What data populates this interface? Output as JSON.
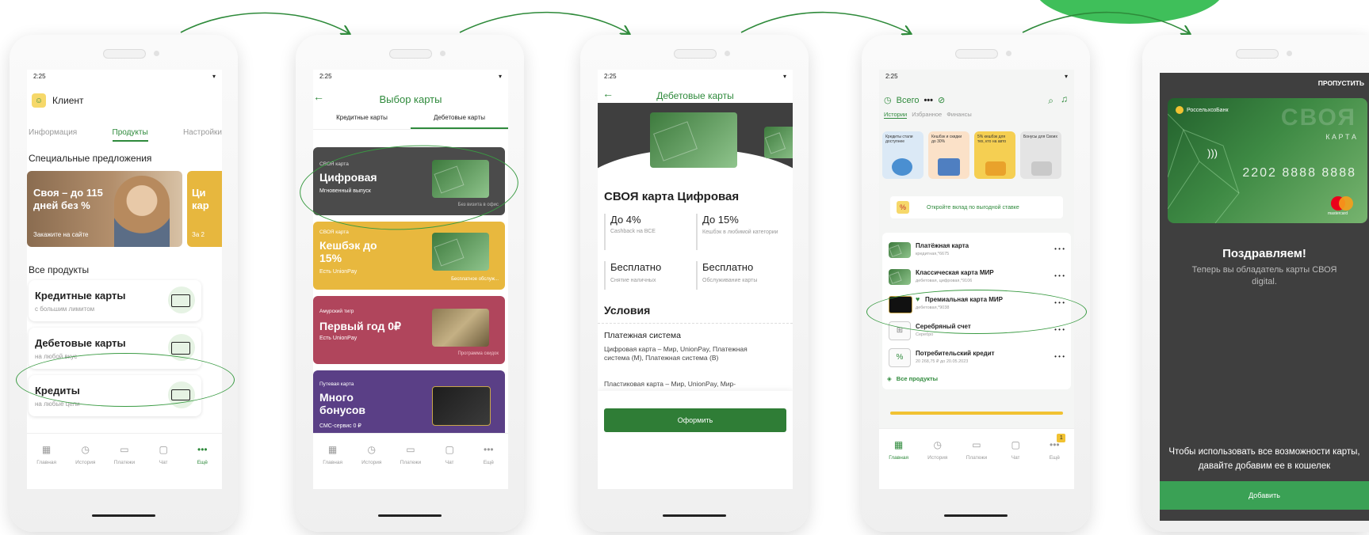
{
  "colors": {
    "accent": "#2f8a3c",
    "arrow": "#2e8a3a",
    "circle": "#3a9b43",
    "blob": "#3fbf5a"
  },
  "status_time": "2:25",
  "tabbar": {
    "home": "Главная",
    "history": "История",
    "payments": "Платежи",
    "chat": "Чат",
    "more": "Ещё"
  },
  "screen1": {
    "header": "Клиент",
    "tabs": [
      "Информация",
      "Продукты",
      "Настройки"
    ],
    "special_title": "Специальные предложения",
    "promo_title": "Своя – до 115 дней без %",
    "promo_sub": "Закажите на сайте",
    "promo2_title": "Ци кар",
    "promo2_sub": "За 2",
    "all_products": "Все продукты",
    "products": [
      {
        "title": "Кредитные карты",
        "subtitle": "с большим лимитом"
      },
      {
        "title": "Дебетовые карты",
        "subtitle": "на любой вкус"
      },
      {
        "title": "Кредиты",
        "subtitle": "на любые цели"
      }
    ]
  },
  "screen2": {
    "title": "Выбор карты",
    "tabs": [
      "Кредитные карты",
      "Дебетовые карты"
    ],
    "cards": [
      {
        "kicker": "СВОЯ карта",
        "title": "Цифровая",
        "subtitle": "Мгновенный выпуск",
        "note": "Без визита в офис",
        "bg": "#4b4b4b"
      },
      {
        "kicker": "СВОЯ карта",
        "title": "Кешбэк до 15%",
        "subtitle": "Есть UnionPay",
        "note": "Бесплатное обслуж...",
        "bg": "#e8b83e"
      },
      {
        "kicker": "Амурский тигр",
        "title": "Первый год 0₽",
        "subtitle": "Есть UnionPay",
        "note": "Программа скидок",
        "bg": "#b0455c"
      },
      {
        "kicker": "Путевая карта",
        "title": "Много бонусов",
        "subtitle": "СМС-сервис 0 ₽",
        "note": "",
        "bg": "#5a3f86"
      }
    ]
  },
  "screen3": {
    "title": "Дебетовые карты",
    "card_name": "СВОЯ карта Цифровая",
    "features": [
      {
        "value": "До 4%",
        "label": "Cashback на ВСЕ"
      },
      {
        "value": "До 15%",
        "label": "Кешбэк в любимой категории"
      },
      {
        "value": "Бесплатно",
        "label": "Снятие наличных"
      },
      {
        "value": "Бесплатно",
        "label": "Обслуживание карты"
      }
    ],
    "conditions": "Условия",
    "payment_system_title": "Платежная система",
    "payment_system_text": "Цифровая карта – Мир, UnionPay, Платежная система (М), Платежная система (В)",
    "plastic_text": "Пластиковая карта – Мир, UnionPay, Мир-",
    "button": "Оформить"
  },
  "screen4": {
    "total": "Всего",
    "tabs": [
      "Истории",
      "Избранное",
      "Финансы"
    ],
    "stories": [
      "Кредиты стали доступнее",
      "Кешбэк и скидки до 30%",
      "5% кешбэк для тех, кто на авто",
      "Бонусы для Своих"
    ],
    "banner": "Откройте вклад по выгодной ставке",
    "products": [
      {
        "title": "Платёжная карта",
        "sub": "кредитная,*6675",
        "icon": "card"
      },
      {
        "title": "Классическая карта МИР",
        "sub": "дебетовая, цифровая,*9106",
        "icon": "card"
      },
      {
        "title": "Премиальная карта МИР",
        "sub": "дебетовая,*9038",
        "icon": "card-black"
      },
      {
        "title": "Серебряный счет",
        "sub": "Серебро",
        "icon": "silver"
      },
      {
        "title": "Потребительский кредит",
        "sub": "20 268,75 ₽ до 20.05.2023",
        "icon": "percent"
      }
    ],
    "more_dots": "• • •",
    "all_products": "Все продукты",
    "badge": "1"
  },
  "screen5": {
    "skip": "ПРОПУСТИТЬ",
    "bank": "РоссельхозБанк",
    "brand": "СВОЯ",
    "brand_sub": "К А Р Т А",
    "card_number": "2202 8888 8888",
    "card_brand": "mastercard",
    "congrats": "Поздравляем!",
    "owner_text": "Теперь вы обладатель карты СВОЯ digital.",
    "wallet_text": "Чтобы использовать все возможности карты, давайте добавим ее в кошелек",
    "button": "Добавить"
  }
}
